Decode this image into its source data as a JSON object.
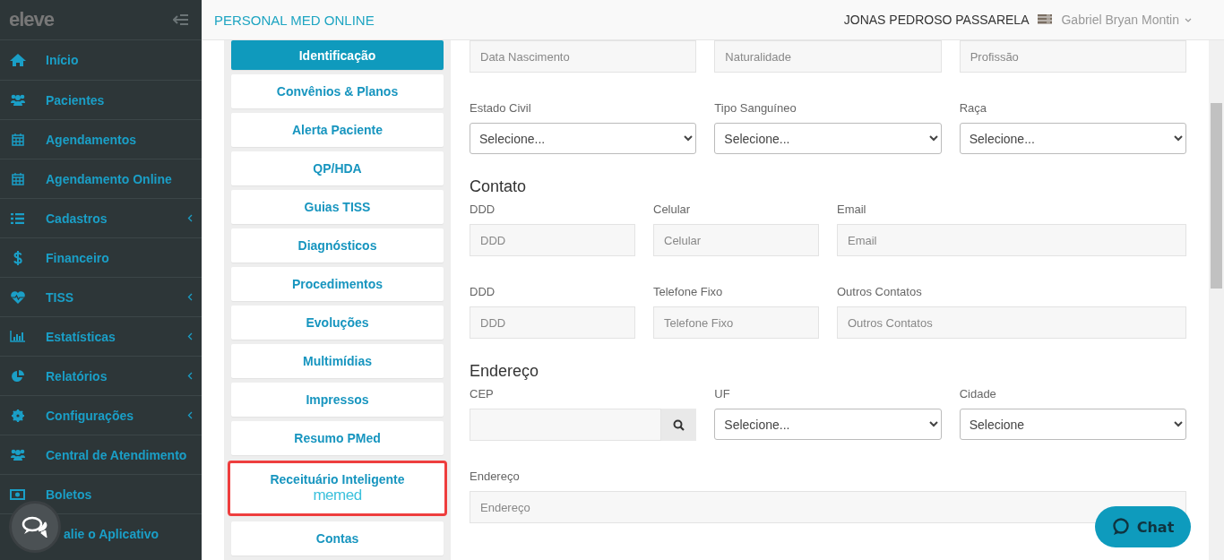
{
  "sidebar": {
    "logo": "eleve",
    "items": [
      {
        "label": "Início",
        "submenu": false
      },
      {
        "label": "Pacientes",
        "submenu": false
      },
      {
        "label": "Agendamentos",
        "submenu": false
      },
      {
        "label": "Agendamento Online",
        "submenu": false
      },
      {
        "label": "Cadastros",
        "submenu": true
      },
      {
        "label": "Financeiro",
        "submenu": false
      },
      {
        "label": "TISS",
        "submenu": true
      },
      {
        "label": "Estatísticas",
        "submenu": true
      },
      {
        "label": "Relatórios",
        "submenu": true
      },
      {
        "label": "Configurações",
        "submenu": true
      },
      {
        "label": "Central de Atendimento",
        "submenu": false
      },
      {
        "label": "Boletos",
        "submenu": false
      },
      {
        "label": "alie o Aplicativo",
        "submenu": false
      }
    ]
  },
  "header": {
    "brand": "PERSONAL MED ONLINE",
    "patient": "JONAS PEDROSO PASSARELA",
    "user": "Gabriel Bryan Montin"
  },
  "tabs": [
    {
      "label": "Identificação",
      "selected": true,
      "highlighted": false
    },
    {
      "label": "Convênios & Planos",
      "selected": false,
      "highlighted": false
    },
    {
      "label": "Alerta Paciente",
      "selected": false,
      "highlighted": false
    },
    {
      "label": "QP/HDA",
      "selected": false,
      "highlighted": false
    },
    {
      "label": "Guias TISS",
      "selected": false,
      "highlighted": false
    },
    {
      "label": "Diagnósticos",
      "selected": false,
      "highlighted": false
    },
    {
      "label": "Procedimentos",
      "selected": false,
      "highlighted": false
    },
    {
      "label": "Evoluções",
      "selected": false,
      "highlighted": false
    },
    {
      "label": "Multimídias",
      "selected": false,
      "highlighted": false
    },
    {
      "label": "Impressos",
      "selected": false,
      "highlighted": false
    },
    {
      "label": "Resumo PMed",
      "selected": false,
      "highlighted": false
    },
    {
      "label": "Receituário Inteligente",
      "logo": "memed",
      "selected": false,
      "highlighted": true
    },
    {
      "label": "Contas",
      "selected": false,
      "highlighted": false
    }
  ],
  "form": [
    {
      "kind": "thirds",
      "fields": [
        {
          "kind": "input",
          "placeholder": "Data Nascimento"
        },
        {
          "kind": "input",
          "placeholder": "Naturalidade"
        },
        {
          "kind": "input",
          "placeholder": "Profissão"
        }
      ]
    },
    {
      "kind": "thirds",
      "fields": [
        {
          "kind": "select",
          "label": "Estado Civil",
          "value": "Selecione..."
        },
        {
          "kind": "select",
          "label": "Tipo Sanguíneo",
          "value": "Selecione..."
        },
        {
          "kind": "select",
          "label": "Raça",
          "value": "Selecione..."
        }
      ]
    },
    {
      "heading": "Contato",
      "kind": "contact",
      "fields": [
        {
          "kind": "input",
          "label": "DDD",
          "placeholder": "DDD"
        },
        {
          "kind": "input",
          "label": "Celular",
          "placeholder": "Celular"
        },
        {
          "kind": "input",
          "label": "Email",
          "placeholder": "Email"
        }
      ]
    },
    {
      "kind": "contact",
      "fields": [
        {
          "kind": "input",
          "label": "DDD",
          "placeholder": "DDD"
        },
        {
          "kind": "input",
          "label": "Telefone Fixo",
          "placeholder": "Telefone Fixo"
        },
        {
          "kind": "input",
          "label": "Outros Contatos",
          "placeholder": "Outros Contatos"
        }
      ]
    },
    {
      "heading": "Endereço",
      "kind": "thirds",
      "fields": [
        {
          "kind": "search",
          "label": "CEP"
        },
        {
          "kind": "select",
          "label": "UF",
          "value": "Selecione..."
        },
        {
          "kind": "select",
          "label": "Cidade",
          "value": "Selecione"
        }
      ]
    },
    {
      "kind": "full",
      "fields": [
        {
          "kind": "input",
          "label": "Endereço",
          "placeholder": "Endereço"
        }
      ]
    }
  ],
  "chat": {
    "label": "Chat"
  }
}
